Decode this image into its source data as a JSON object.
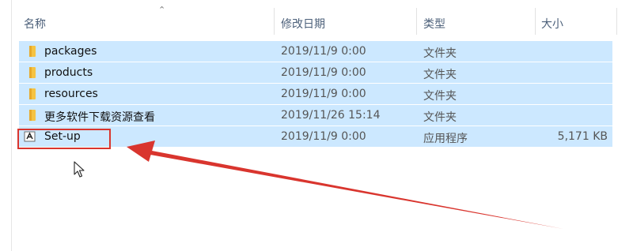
{
  "columns": {
    "name": "名称",
    "date": "修改日期",
    "type": "类型",
    "size": "大小"
  },
  "files": [
    {
      "name": "packages",
      "date": "2019/11/9 0:00",
      "type": "文件夹",
      "size": "",
      "icon": "folder-icon"
    },
    {
      "name": "products",
      "date": "2019/11/9 0:00",
      "type": "文件夹",
      "size": "",
      "icon": "folder-icon"
    },
    {
      "name": "resources",
      "date": "2019/11/9 0:00",
      "type": "文件夹",
      "size": "",
      "icon": "folder-icon"
    },
    {
      "name": "更多软件下载资源查看",
      "date": "2019/11/26 15:14",
      "type": "文件夹",
      "size": "",
      "icon": "folder-icon"
    },
    {
      "name": "Set-up",
      "date": "2019/11/9 0:00",
      "type": "应用程序",
      "size": "5,171 KB",
      "icon": "adobe-app-icon"
    }
  ],
  "colors": {
    "selection": "#cce8ff",
    "annotation": "#d9352e",
    "folder": "#f5c342"
  }
}
